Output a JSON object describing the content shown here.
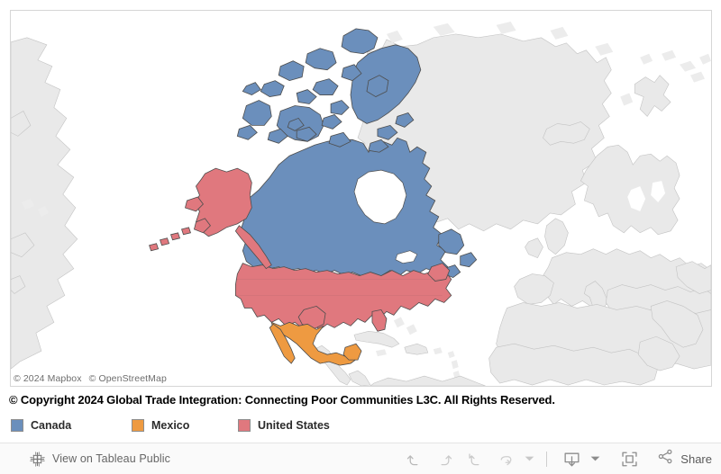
{
  "map": {
    "attribution": [
      "© 2024 Mapbox",
      "© OpenStreetMap"
    ],
    "basemap_land_color": "#e9e9e9",
    "basemap_border_color": "#bfbfbf",
    "ocean_color": "#ffffff",
    "highlight_stroke": "#4d4d4d"
  },
  "caption": {
    "text": "© Copyright 2024 Global Trade Integration: Connecting Poor Communities L3C. All Rights Reserved."
  },
  "legend": {
    "items": [
      {
        "label": "Canada",
        "color": "#6b8fbc"
      },
      {
        "label": "Mexico",
        "color": "#ee9a41"
      },
      {
        "label": "United States",
        "color": "#e0787e"
      }
    ]
  },
  "toolbar": {
    "view_on_tableau_public": "View on Tableau Public",
    "share_label": "Share",
    "icons": [
      "undo-icon",
      "redo-icon",
      "revert-icon",
      "refresh-icon",
      "refresh-caret-icon",
      "download-icon",
      "download-caret-icon",
      "fullscreen-icon",
      "share-icon"
    ]
  }
}
